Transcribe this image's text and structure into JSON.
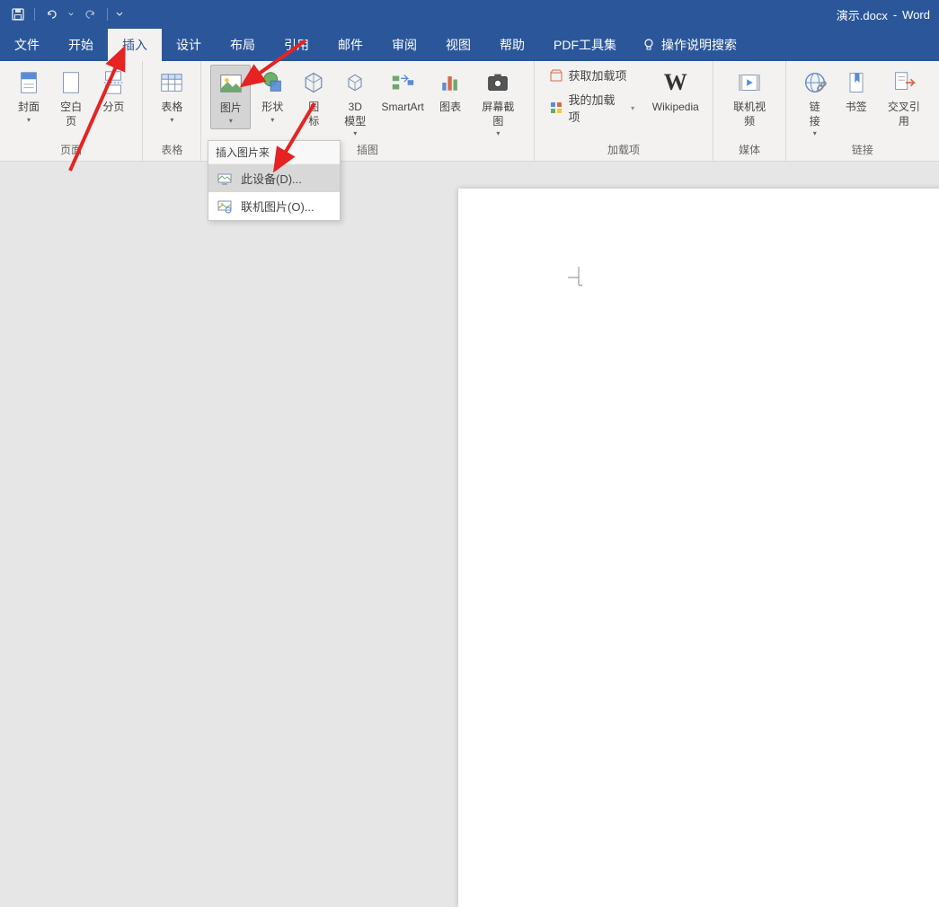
{
  "app_name": "Word",
  "document_name": "演示.docx",
  "title_separator": "-",
  "qat": {
    "save": "保存",
    "undo": "撤销",
    "redo": "重做",
    "customize": "自定义"
  },
  "tabs": {
    "file": "文件",
    "home": "开始",
    "insert": "插入",
    "design": "设计",
    "layout": "布局",
    "references": "引用",
    "mailings": "邮件",
    "review": "审阅",
    "view": "视图",
    "help": "帮助",
    "pdf": "PDF工具集"
  },
  "tell_me": "操作说明搜索",
  "ribbon": {
    "groups": {
      "pages": {
        "label": "页面",
        "cover": "封面",
        "blank": "空白页",
        "break": "分页"
      },
      "tables": {
        "label": "表格",
        "table": "表格"
      },
      "illustrations": {
        "label": "插图",
        "picture": "图片",
        "shapes": "形状",
        "icons": "图\n标",
        "model3d": "3D\n模型",
        "smartart": "SmartArt",
        "chart": "图表",
        "screenshot": "屏幕截图"
      },
      "addins": {
        "label": "加载项",
        "get": "获取加载项",
        "my": "我的加载项",
        "wikipedia": "Wikipedia"
      },
      "media": {
        "label": "媒体",
        "video": "联机视频"
      },
      "links": {
        "label": "链接",
        "link": "链\n接",
        "bookmark": "书签",
        "crossref": "交叉引用"
      }
    }
  },
  "dropdown": {
    "header": "插入图片来",
    "this_device": "此设备(D)...",
    "online": "联机图片(O)..."
  }
}
